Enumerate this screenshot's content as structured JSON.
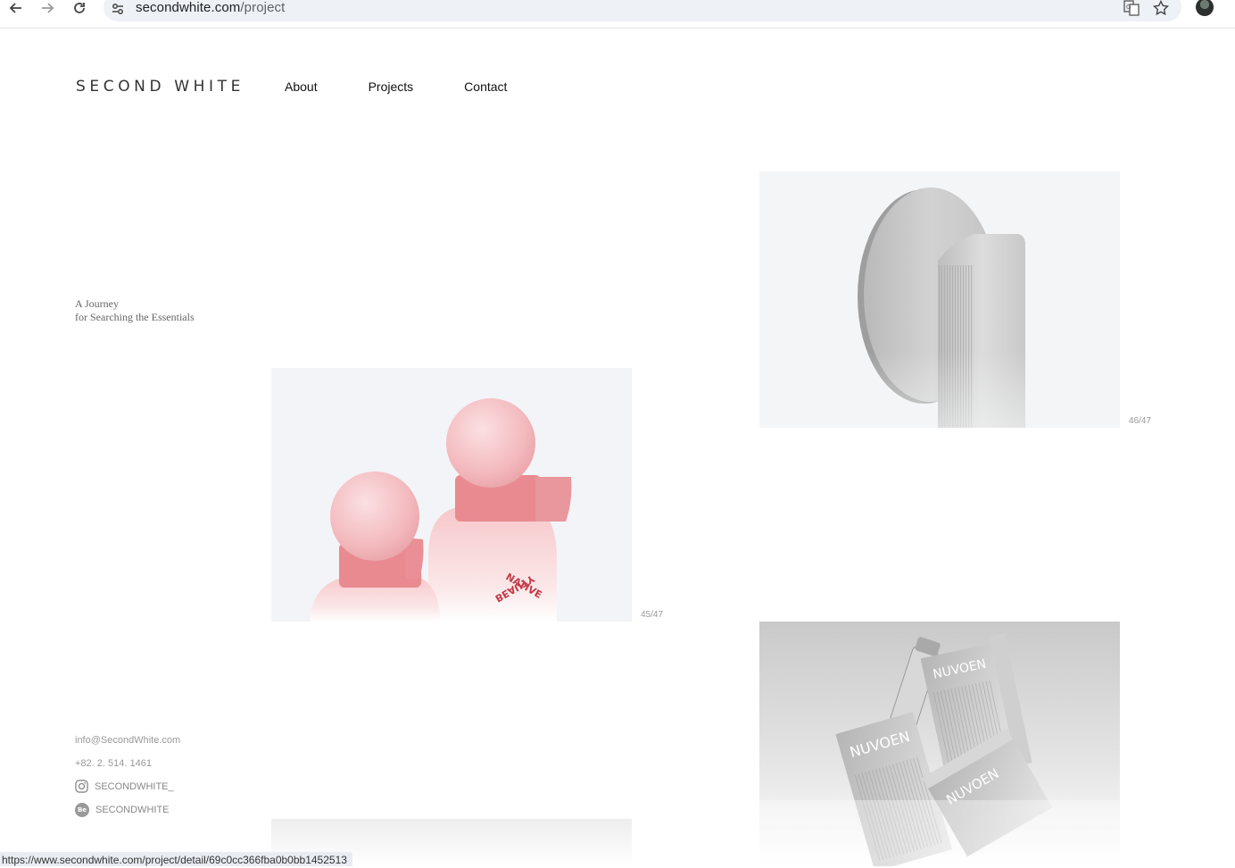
{
  "browser": {
    "url_host": "secondwhite.com",
    "url_path": "/project",
    "status_url": "https://www.secondwhite.com/project/detail/69c0cc366fba0b0bb1452513"
  },
  "site": {
    "logo": "SECOND WHITE",
    "nav": [
      "About",
      "Projects",
      "Contact"
    ],
    "tagline_line1": "A Journey",
    "tagline_line2": "for Searching the Essentials",
    "email": "info@SecondWhite.com",
    "phone": "+82. 2. 514. 1461",
    "instagram": "SECONDWHITE_",
    "behance": "SECONDWHITE",
    "behance_badge": "Be"
  },
  "projects": [
    {
      "counter": "46/47",
      "subject": "door-handle"
    },
    {
      "counter": "45/47",
      "subject": "pink-bottles",
      "label_top": "NATIVE",
      "label_bottom": "BEAUTY"
    },
    {
      "counter": "",
      "subject": "nuvoen-boxes",
      "brand": "NUVOEN"
    }
  ],
  "colors": {
    "accent_pink": "#e8888f",
    "card_bg": "#f4f5f7"
  }
}
